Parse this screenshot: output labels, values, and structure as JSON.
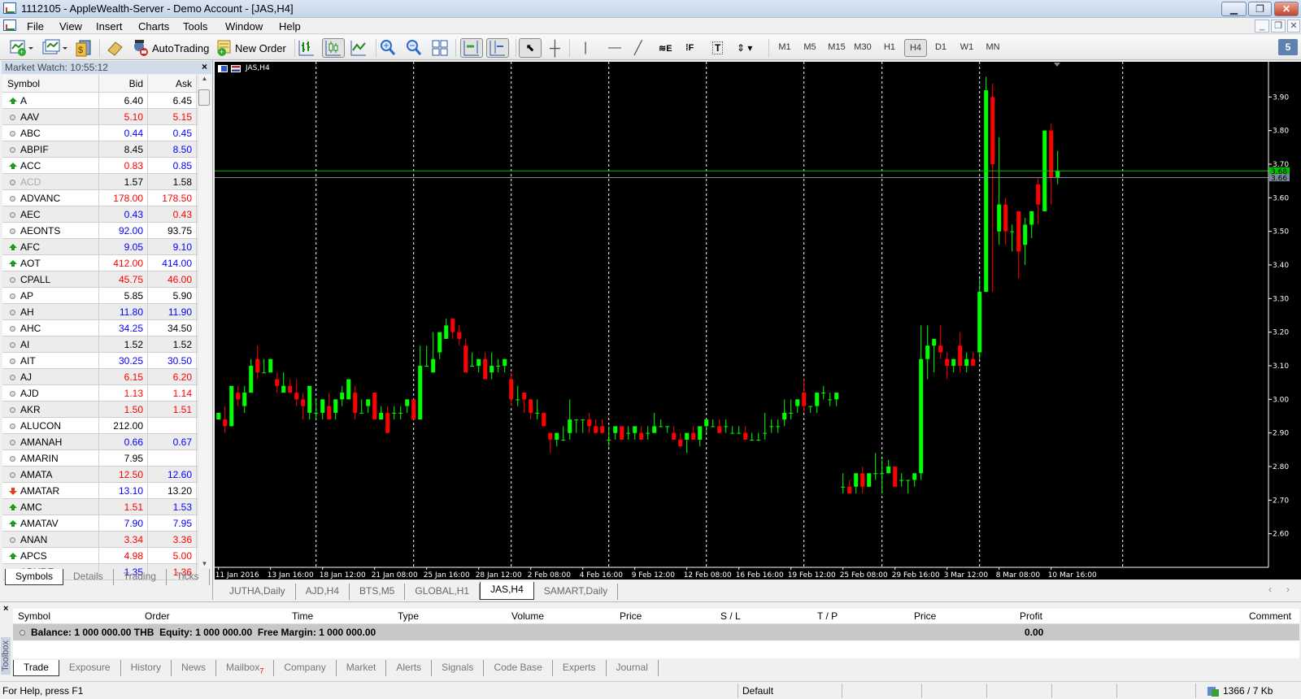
{
  "window": {
    "title": "1112105 - AppleWealth-Server - Demo Account - [JAS,H4]"
  },
  "menu": [
    "File",
    "View",
    "Insert",
    "Charts",
    "Tools",
    "Window",
    "Help"
  ],
  "toolbar": {
    "autotrading_label": "AutoTrading",
    "new_order_label": "New Order",
    "timeframes": [
      "M1",
      "M5",
      "M15",
      "M30",
      "H1",
      "H4",
      "D1",
      "W1",
      "MN"
    ],
    "active_timeframe": "H4",
    "search_placeholder": "",
    "notifications_count": "5"
  },
  "market_watch": {
    "title": "Market Watch: 10:55:12",
    "columns": {
      "symbol": "Symbol",
      "bid": "Bid",
      "ask": "Ask"
    },
    "colors": {
      "b": "#000000",
      "r": "#ff0000",
      "u": "#0000ff"
    },
    "rows": [
      {
        "symbol": "A",
        "trend": "up",
        "bid": "6.40",
        "bc": "b",
        "ask": "6.45",
        "ac": "b"
      },
      {
        "symbol": "AAV",
        "trend": "none",
        "bid": "5.10",
        "bc": "r",
        "ask": "5.15",
        "ac": "r"
      },
      {
        "symbol": "ABC",
        "trend": "none",
        "bid": "0.44",
        "bc": "u",
        "ask": "0.45",
        "ac": "u"
      },
      {
        "symbol": "ABPIF",
        "trend": "none",
        "bid": "8.45",
        "bc": "b",
        "ask": "8.50",
        "ac": "u"
      },
      {
        "symbol": "ACC",
        "trend": "up",
        "bid": "0.83",
        "bc": "r",
        "ask": "0.85",
        "ac": "u"
      },
      {
        "symbol": "ACD",
        "trend": "none",
        "disabled": true,
        "bid": "1.57",
        "bc": "b",
        "ask": "1.58",
        "ac": "b"
      },
      {
        "symbol": "ADVANC",
        "trend": "none",
        "bid": "178.00",
        "bc": "r",
        "ask": "178.50",
        "ac": "r"
      },
      {
        "symbol": "AEC",
        "trend": "none",
        "bid": "0.43",
        "bc": "u",
        "ask": "0.43",
        "ac": "r"
      },
      {
        "symbol": "AEONTS",
        "trend": "none",
        "bid": "92.00",
        "bc": "u",
        "ask": "93.75",
        "ac": "b"
      },
      {
        "symbol": "AFC",
        "trend": "up",
        "bid": "9.05",
        "bc": "u",
        "ask": "9.10",
        "ac": "u"
      },
      {
        "symbol": "AOT",
        "trend": "up",
        "bid": "412.00",
        "bc": "r",
        "ask": "414.00",
        "ac": "u"
      },
      {
        "symbol": "CPALL",
        "trend": "none",
        "bid": "45.75",
        "bc": "r",
        "ask": "46.00",
        "ac": "r"
      },
      {
        "symbol": "AP",
        "trend": "none",
        "bid": "5.85",
        "bc": "b",
        "ask": "5.90",
        "ac": "b"
      },
      {
        "symbol": "AH",
        "trend": "none",
        "bid": "11.80",
        "bc": "u",
        "ask": "11.90",
        "ac": "u"
      },
      {
        "symbol": "AHC",
        "trend": "none",
        "bid": "34.25",
        "bc": "u",
        "ask": "34.50",
        "ac": "b"
      },
      {
        "symbol": "AI",
        "trend": "none",
        "bid": "1.52",
        "bc": "b",
        "ask": "1.52",
        "ac": "b"
      },
      {
        "symbol": "AIT",
        "trend": "none",
        "bid": "30.25",
        "bc": "u",
        "ask": "30.50",
        "ac": "u"
      },
      {
        "symbol": "AJ",
        "trend": "none",
        "bid": "6.15",
        "bc": "r",
        "ask": "6.20",
        "ac": "r"
      },
      {
        "symbol": "AJD",
        "trend": "none",
        "bid": "1.13",
        "bc": "r",
        "ask": "1.14",
        "ac": "r"
      },
      {
        "symbol": "AKR",
        "trend": "none",
        "bid": "1.50",
        "bc": "r",
        "ask": "1.51",
        "ac": "r"
      },
      {
        "symbol": "ALUCON",
        "trend": "none",
        "bid": "212.00",
        "bc": "b",
        "ask": "",
        "ac": "b"
      },
      {
        "symbol": "AMANAH",
        "trend": "none",
        "bid": "0.66",
        "bc": "u",
        "ask": "0.67",
        "ac": "u"
      },
      {
        "symbol": "AMARIN",
        "trend": "none",
        "bid": "7.95",
        "bc": "b",
        "ask": "",
        "ac": "b"
      },
      {
        "symbol": "AMATA",
        "trend": "none",
        "bid": "12.50",
        "bc": "r",
        "ask": "12.60",
        "ac": "u"
      },
      {
        "symbol": "AMATAR",
        "trend": "down",
        "bid": "13.10",
        "bc": "u",
        "ask": "13.20",
        "ac": "b"
      },
      {
        "symbol": "AMC",
        "trend": "up",
        "bid": "1.51",
        "bc": "r",
        "ask": "1.53",
        "ac": "u"
      },
      {
        "symbol": "AMATAV",
        "trend": "up",
        "bid": "7.90",
        "bc": "u",
        "ask": "7.95",
        "ac": "u"
      },
      {
        "symbol": "ANAN",
        "trend": "none",
        "bid": "3.34",
        "bc": "r",
        "ask": "3.36",
        "ac": "r"
      },
      {
        "symbol": "APCS",
        "trend": "up",
        "bid": "4.98",
        "bc": "r",
        "ask": "5.00",
        "ac": "r"
      },
      {
        "symbol": "APURE",
        "trend": "none",
        "bid": "1.35",
        "bc": "u",
        "ask": "1.36",
        "ac": "r"
      }
    ],
    "tabs": [
      "Symbols",
      "Details",
      "Trading",
      "Ticks"
    ],
    "active_tab": "Symbols"
  },
  "chart_tabs": [
    "JUTHA,Daily",
    "AJD,H4",
    "BTS,M5",
    "GLOBAL,H1",
    "JAS,H4",
    "SAMART,Daily"
  ],
  "active_chart_tab": "JAS,H4",
  "chart_data": {
    "type": "candlestick",
    "title": "JAS,H4",
    "ylim": [
      2.5,
      4.0
    ],
    "yticks": [
      "3.90",
      "3.80",
      "3.70",
      "3.60",
      "3.50",
      "3.40",
      "3.30",
      "3.20",
      "3.10",
      "3.00",
      "2.90",
      "2.80",
      "2.70",
      "2.60"
    ],
    "bid_line": {
      "value": 3.68,
      "label": "3.68",
      "color": "#00c000"
    },
    "ask_line": {
      "value": 3.66,
      "label": "3.66",
      "color": "#778899"
    },
    "up_color": "#00ff00",
    "down_color": "#ff0000",
    "xlabels": [
      "11 Jan 2016",
      "13 Jan 16:00",
      "18 Jan 12:00",
      "21 Jan 08:00",
      "25 Jan 16:00",
      "28 Jan 12:00",
      "2 Feb 08:00",
      "4 Feb 16:00",
      "9 Feb 12:00",
      "12 Feb 08:00",
      "16 Feb 16:00",
      "19 Feb 12:00",
      "25 Feb 08:00",
      "29 Feb 16:00",
      "3 Mar 12:00",
      "8 Mar 08:00",
      "10 Mar 16:00"
    ],
    "xlabel_every_bars": 8,
    "period_separator_bars": [
      15,
      30,
      45,
      60,
      75,
      90,
      102,
      117,
      139
    ],
    "ohlc": [
      [
        2.94,
        2.96,
        2.94,
        2.96
      ],
      [
        2.94,
        2.98,
        2.9,
        2.92
      ],
      [
        2.92,
        3.04,
        2.92,
        3.04
      ],
      [
        3.02,
        3.04,
        2.98,
        3.0
      ],
      [
        2.98,
        3.04,
        2.96,
        3.02
      ],
      [
        3.02,
        3.12,
        3.02,
        3.1
      ],
      [
        3.12,
        3.16,
        3.06,
        3.08
      ],
      [
        3.08,
        3.12,
        3.08,
        3.08
      ],
      [
        3.08,
        3.12,
        3.08,
        3.12
      ],
      [
        3.06,
        3.08,
        3.02,
        3.04
      ],
      [
        3.02,
        3.08,
        3.02,
        3.04
      ],
      [
        3.04,
        3.06,
        3.02,
        3.02
      ],
      [
        3.02,
        3.06,
        2.98,
        3.0
      ],
      [
        3.0,
        3.02,
        2.94,
        2.98
      ],
      [
        2.96,
        3.04,
        2.94,
        3.04
      ],
      [
        2.96,
        3.0,
        2.94,
        2.96
      ],
      [
        2.96,
        3.0,
        2.94,
        3.0
      ],
      [
        2.98,
        3.02,
        2.94,
        2.94
      ],
      [
        2.96,
        3.0,
        2.94,
        3.0
      ],
      [
        3.0,
        3.04,
        2.98,
        3.02
      ],
      [
        3.0,
        3.06,
        3.0,
        3.06
      ],
      [
        3.02,
        3.04,
        2.94,
        2.96
      ],
      [
        2.96,
        3.0,
        2.96,
        2.96
      ],
      [
        2.98,
        3.0,
        2.96,
        3.0
      ],
      [
        3.02,
        3.02,
        2.94,
        2.94
      ],
      [
        2.94,
        2.98,
        2.94,
        2.96
      ],
      [
        2.96,
        2.98,
        2.9,
        2.9
      ],
      [
        2.96,
        2.98,
        2.94,
        2.96
      ],
      [
        2.96,
        2.98,
        2.94,
        2.96
      ],
      [
        2.98,
        3.0,
        2.96,
        3.0
      ],
      [
        3.0,
        3.0,
        2.94,
        2.94
      ],
      [
        2.94,
        3.16,
        2.94,
        3.1
      ],
      [
        3.1,
        3.16,
        3.1,
        3.1
      ],
      [
        3.08,
        3.2,
        3.08,
        3.12
      ],
      [
        3.14,
        3.2,
        3.12,
        3.2
      ],
      [
        3.18,
        3.24,
        3.18,
        3.22
      ],
      [
        3.24,
        3.24,
        3.18,
        3.2
      ],
      [
        3.2,
        3.22,
        3.16,
        3.18
      ],
      [
        3.16,
        3.18,
        3.08,
        3.08
      ],
      [
        3.1,
        3.14,
        3.1,
        3.1
      ],
      [
        3.1,
        3.12,
        3.08,
        3.12
      ],
      [
        3.12,
        3.14,
        3.06,
        3.06
      ],
      [
        3.08,
        3.14,
        3.06,
        3.1
      ],
      [
        3.1,
        3.12,
        3.08,
        3.1
      ],
      [
        3.1,
        3.12,
        3.08,
        3.12
      ],
      [
        3.06,
        3.08,
        2.98,
        3.0
      ],
      [
        3.0,
        3.04,
        2.98,
        3.0
      ],
      [
        3.02,
        3.02,
        2.96,
        3.0
      ],
      [
        3.0,
        3.0,
        2.94,
        2.96
      ],
      [
        2.96,
        3.0,
        2.94,
        2.96
      ],
      [
        2.96,
        2.96,
        2.92,
        2.92
      ],
      [
        2.9,
        2.9,
        2.84,
        2.88
      ],
      [
        2.88,
        2.9,
        2.86,
        2.9
      ],
      [
        2.88,
        2.92,
        2.88,
        2.88
      ],
      [
        2.9,
        3.0,
        2.88,
        2.94
      ],
      [
        2.94,
        2.94,
        2.9,
        2.94
      ],
      [
        2.94,
        2.94,
        2.9,
        2.94
      ],
      [
        2.94,
        2.96,
        2.9,
        2.92
      ],
      [
        2.92,
        2.94,
        2.9,
        2.9
      ],
      [
        2.92,
        2.94,
        2.9,
        2.9
      ],
      [
        2.88,
        2.92,
        2.86,
        2.88
      ],
      [
        2.9,
        2.92,
        2.88,
        2.92
      ],
      [
        2.92,
        2.92,
        2.88,
        2.88
      ],
      [
        2.9,
        2.92,
        2.88,
        2.9
      ],
      [
        2.9,
        2.92,
        2.88,
        2.92
      ],
      [
        2.9,
        2.92,
        2.88,
        2.88
      ],
      [
        2.9,
        2.92,
        2.88,
        2.9
      ],
      [
        2.9,
        2.96,
        2.9,
        2.92
      ],
      [
        2.92,
        2.94,
        2.92,
        2.92
      ],
      [
        2.92,
        2.92,
        2.9,
        2.92
      ],
      [
        2.9,
        2.92,
        2.88,
        2.88
      ],
      [
        2.88,
        2.9,
        2.86,
        2.86
      ],
      [
        2.88,
        2.9,
        2.84,
        2.9
      ],
      [
        2.9,
        2.92,
        2.88,
        2.88
      ],
      [
        2.88,
        2.92,
        2.86,
        2.92
      ],
      [
        2.92,
        2.94,
        2.9,
        2.94
      ],
      [
        2.92,
        2.94,
        2.92,
        2.92
      ],
      [
        2.92,
        2.94,
        2.9,
        2.9
      ],
      [
        2.92,
        2.94,
        2.9,
        2.92
      ],
      [
        2.9,
        2.92,
        2.9,
        2.9
      ],
      [
        2.9,
        2.92,
        2.9,
        2.9
      ],
      [
        2.9,
        2.92,
        2.88,
        2.88
      ],
      [
        2.88,
        2.9,
        2.88,
        2.88
      ],
      [
        2.88,
        2.9,
        2.88,
        2.88
      ],
      [
        2.9,
        2.96,
        2.88,
        2.9
      ],
      [
        2.92,
        2.94,
        2.9,
        2.92
      ],
      [
        2.92,
        2.94,
        2.9,
        2.92
      ],
      [
        2.94,
        3.0,
        2.92,
        2.96
      ],
      [
        2.96,
        3.0,
        2.94,
        2.96
      ],
      [
        2.98,
        3.0,
        2.96,
        3.0
      ],
      [
        3.02,
        3.06,
        2.96,
        2.98
      ],
      [
        2.98,
        2.98,
        2.96,
        2.98
      ],
      [
        2.98,
        3.02,
        2.96,
        3.02
      ],
      [
        3.02,
        3.04,
        3.0,
        3.02
      ],
      [
        3.0,
        3.02,
        2.98,
        3.0
      ],
      [
        3.0,
        3.02,
        2.98,
        3.02
      ],
      [
        2.74,
        2.78,
        2.72,
        2.74
      ],
      [
        2.74,
        2.76,
        2.72,
        2.72
      ],
      [
        2.74,
        2.78,
        2.72,
        2.78
      ],
      [
        2.78,
        2.8,
        2.72,
        2.74
      ],
      [
        2.74,
        2.78,
        2.74,
        2.78
      ],
      [
        2.78,
        2.84,
        2.76,
        2.78
      ],
      [
        2.78,
        2.82,
        2.72,
        2.78
      ],
      [
        2.78,
        2.82,
        2.78,
        2.8
      ],
      [
        2.8,
        2.8,
        2.74,
        2.74
      ],
      [
        2.76,
        2.78,
        2.74,
        2.76
      ],
      [
        2.76,
        2.76,
        2.72,
        2.76
      ],
      [
        2.76,
        2.78,
        2.74,
        2.78
      ],
      [
        2.78,
        3.22,
        2.76,
        3.12
      ],
      [
        3.12,
        3.22,
        3.06,
        3.16
      ],
      [
        3.16,
        3.18,
        3.08,
        3.18
      ],
      [
        3.16,
        3.22,
        3.12,
        3.14
      ],
      [
        3.12,
        3.14,
        3.06,
        3.1
      ],
      [
        3.1,
        3.12,
        3.08,
        3.12
      ],
      [
        3.16,
        3.2,
        3.08,
        3.1
      ],
      [
        3.1,
        3.14,
        3.08,
        3.12
      ],
      [
        3.12,
        3.14,
        3.1,
        3.1
      ],
      [
        3.14,
        3.36,
        3.12,
        3.32
      ],
      [
        3.32,
        3.96,
        3.32,
        3.92
      ],
      [
        3.9,
        3.94,
        3.32,
        3.7
      ],
      [
        3.5,
        3.78,
        3.46,
        3.58
      ],
      [
        3.58,
        3.6,
        3.46,
        3.5
      ],
      [
        3.5,
        3.52,
        3.44,
        3.5
      ],
      [
        3.56,
        3.56,
        3.36,
        3.44
      ],
      [
        3.46,
        3.54,
        3.4,
        3.52
      ],
      [
        3.52,
        3.56,
        3.48,
        3.56
      ],
      [
        3.64,
        3.66,
        3.52,
        3.58
      ],
      [
        3.56,
        3.8,
        3.56,
        3.8
      ],
      [
        3.8,
        3.82,
        3.58,
        3.66
      ],
      [
        3.66,
        3.74,
        3.64,
        3.68
      ]
    ]
  },
  "terminal": {
    "side_label": "Toolbox",
    "columns": [
      "Symbol",
      "Order",
      "Time",
      "Type",
      "Volume",
      "Price",
      "S / L",
      "T / P",
      "Price",
      "Profit",
      "Comment"
    ],
    "balance_text": "Balance: 1 000 000.00 THB  Equity: 1 000 000.00  Free Margin: 1 000 000.00",
    "profit": "0.00",
    "tabs": [
      "Trade",
      "Exposure",
      "History",
      "News",
      "Mailbox",
      "Company",
      "Market",
      "Alerts",
      "Signals",
      "Code Base",
      "Experts",
      "Journal"
    ],
    "mailbox_count": "7",
    "active_tab": "Trade"
  },
  "status": {
    "help": "For Help, press F1",
    "profile": "Default",
    "traffic": "1366 / 7 Kb"
  }
}
